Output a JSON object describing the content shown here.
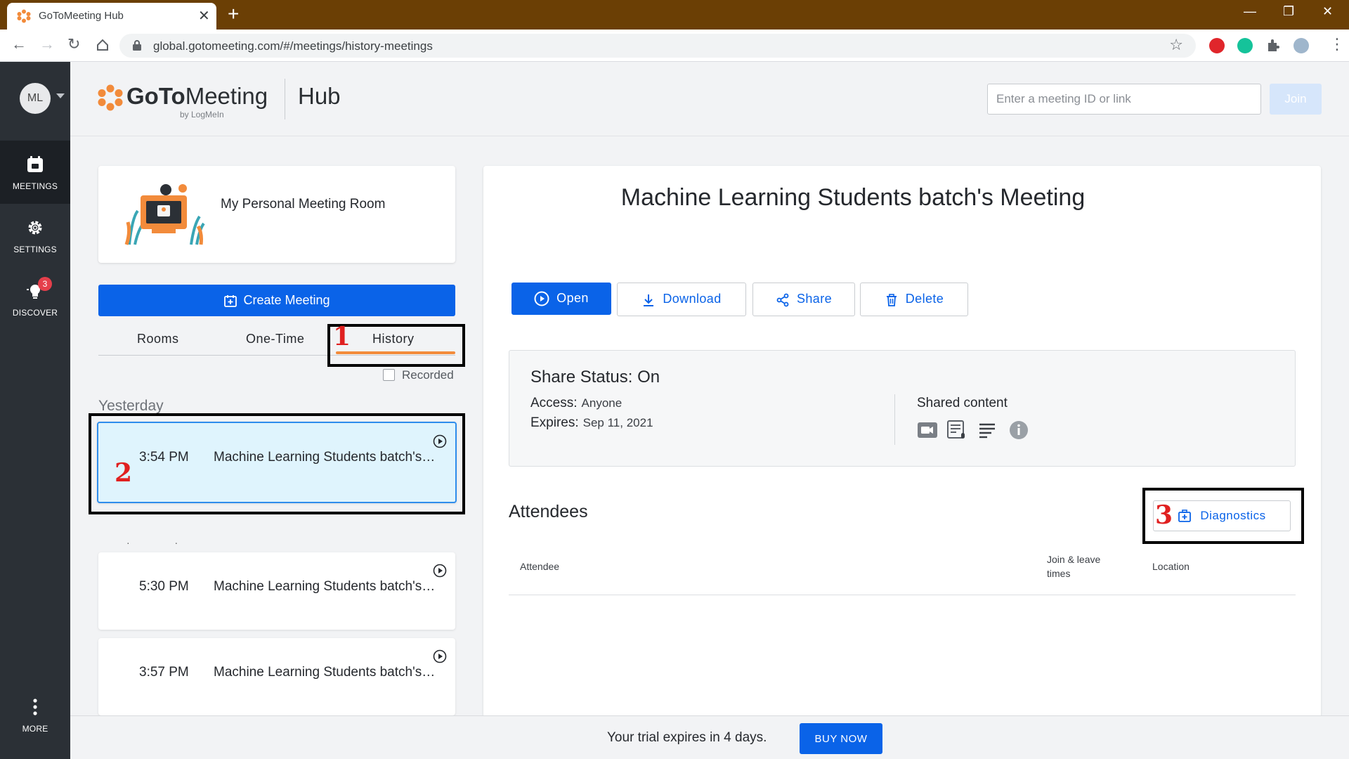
{
  "browser": {
    "tab_title": "GoToMeeting Hub",
    "new_tab_glyph": "+",
    "url": "global.gotomeeting.com/#/meetings/history-meetings"
  },
  "leftnav": {
    "avatar_initials": "ML",
    "items": [
      {
        "label": "MEETINGS",
        "icon": "calendar-icon"
      },
      {
        "label": "SETTINGS",
        "icon": "gear-icon"
      },
      {
        "label": "DISCOVER",
        "icon": "lightbulb-icon",
        "badge": "3"
      },
      {
        "label": "MORE",
        "icon": "more-vertical-icon"
      }
    ]
  },
  "header": {
    "logo_goto": "GoTo",
    "logo_meeting": "Meeting",
    "logo_by": "by LogMeIn",
    "product": "Hub",
    "meeting_input_placeholder": "Enter a meeting ID or link",
    "join_label": "Join"
  },
  "left": {
    "personal_room_title": "My Personal Meeting Room",
    "create_meeting_label": "Create Meeting",
    "tabs": [
      "Rooms",
      "One-Time",
      "History"
    ],
    "active_tab": "History",
    "recorded_label": "Recorded",
    "section_label": "Yesterday",
    "meetings": [
      {
        "time": "3:54 PM",
        "title": "Machine Learning Students batch's Meeting",
        "selected": true
      },
      {
        "time": "5:30 PM",
        "title": "Machine Learning Students batch's Meeting",
        "selected": false
      },
      {
        "time": "3:57 PM",
        "title": "Machine Learning Students batch's Meeting",
        "selected": false
      }
    ]
  },
  "detail": {
    "title": "Machine Learning Students batch's Meeting",
    "actions": {
      "open": "Open",
      "download": "Download",
      "share": "Share",
      "delete": "Delete"
    },
    "share_status": "Share Status: On",
    "access_label": "Access:",
    "access_value": "Anyone",
    "expires_label": "Expires:",
    "expires_value": "Sep 11, 2021",
    "shared_content_title": "Shared content",
    "shared_content_icons": [
      "video-icon",
      "transcript-icon",
      "notes-icon",
      "info-icon"
    ],
    "attendees_title": "Attendees",
    "diagnostics_label": "Diagnostics",
    "columns": {
      "attendee": "Attendee",
      "join_leave_1": "Join & leave",
      "join_leave_2": "times",
      "location": "Location"
    }
  },
  "footer": {
    "trial_text": "Your trial expires in 4 days.",
    "buy_label": "BUY NOW"
  },
  "annotations": [
    "1",
    "2",
    "3"
  ],
  "colors": {
    "accent_blue": "#0a63e8",
    "brand_orange": "#f28b3b",
    "selected_bg": "#dff4fd",
    "nav_bg": "#2b3036",
    "annotation_red": "#e02020"
  }
}
